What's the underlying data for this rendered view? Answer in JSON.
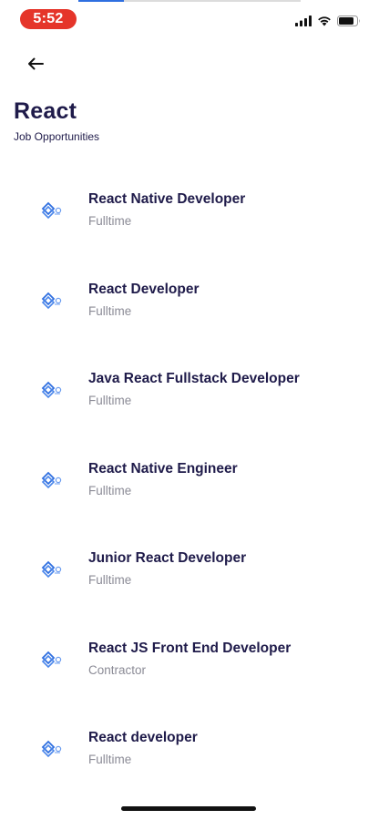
{
  "status_bar": {
    "time": "5:52",
    "signal_icon": "cellular-signal-icon",
    "wifi_icon": "wifi-icon",
    "battery_icon": "battery-icon"
  },
  "header": {
    "back_icon": "arrow-left-icon",
    "title": "React",
    "subtitle": "Job Opportunities"
  },
  "jobs": [
    {
      "title": "React Native Developer",
      "type": "Fulltime",
      "logo_icon": "company-logo-icon"
    },
    {
      "title": "React Developer",
      "type": "Fulltime",
      "logo_icon": "company-logo-icon"
    },
    {
      "title": "Java React Fullstack Developer",
      "type": "Fulltime",
      "logo_icon": "company-logo-icon"
    },
    {
      "title": "React Native Engineer",
      "type": "Fulltime",
      "logo_icon": "company-logo-icon"
    },
    {
      "title": "Junior React Developer",
      "type": "Fulltime",
      "logo_icon": "company-logo-icon"
    },
    {
      "title": "React JS Front End Developer",
      "type": "Contractor",
      "logo_icon": "company-logo-icon"
    },
    {
      "title": "React developer",
      "type": "Fulltime",
      "logo_icon": "company-logo-icon"
    }
  ],
  "colors": {
    "accent": "#2f6fe0",
    "title_text": "#1f1b4a",
    "secondary_text": "#8b8b96",
    "time_pill": "#e5352a"
  }
}
